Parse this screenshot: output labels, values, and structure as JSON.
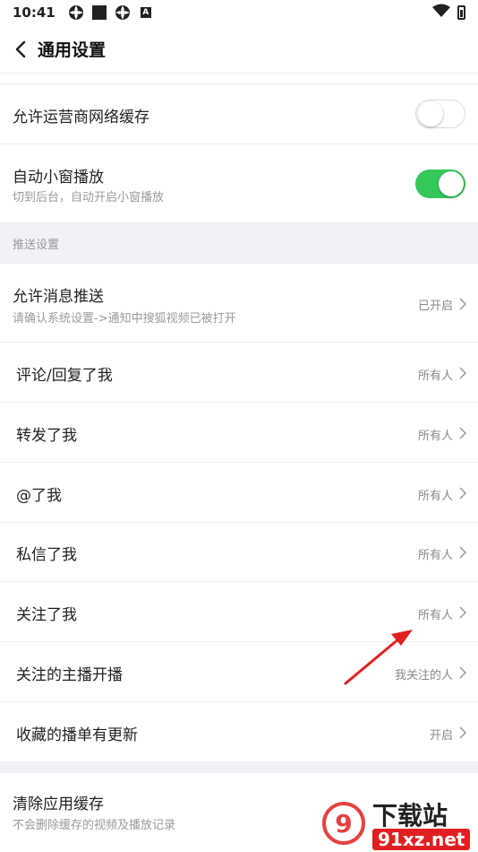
{
  "status": {
    "time": "10:41"
  },
  "header": {
    "title": "通用设置"
  },
  "rows": {
    "carrier_cache": {
      "label": "允许运营商网络缓存",
      "toggle": "off"
    },
    "pip": {
      "label": "自动小窗播放",
      "sub": "切到后台，自动开启小窗播放",
      "toggle": "on"
    },
    "section_push": "推送设置",
    "allow_push": {
      "label": "允许消息推送",
      "sub": "请确认系统设置->通知中搜狐视频已被打开",
      "value": "已开启"
    },
    "comment_reply": {
      "label": "评论/回复了我",
      "value": "所有人"
    },
    "forward": {
      "label": "转发了我",
      "value": "所有人"
    },
    "mention": {
      "label": "@了我",
      "value": "所有人"
    },
    "private_msg": {
      "label": "私信了我",
      "value": "所有人"
    },
    "follow_me": {
      "label": "关注了我",
      "value": "所有人"
    },
    "streamer_live": {
      "label": "关注的主播开播",
      "value": "我关注的人"
    },
    "playlist_update": {
      "label": "收藏的播单有更新",
      "value": "开启"
    },
    "clear_cache": {
      "label": "清除应用缓存",
      "sub": "不会删除缓存的视频及播放记录"
    }
  },
  "watermark": {
    "brand": "下载站",
    "site": "91xz.net"
  },
  "colors": {
    "toggle_on": "#34c759",
    "section_bg": "#f0f2f5",
    "arrow": "#e02020"
  }
}
